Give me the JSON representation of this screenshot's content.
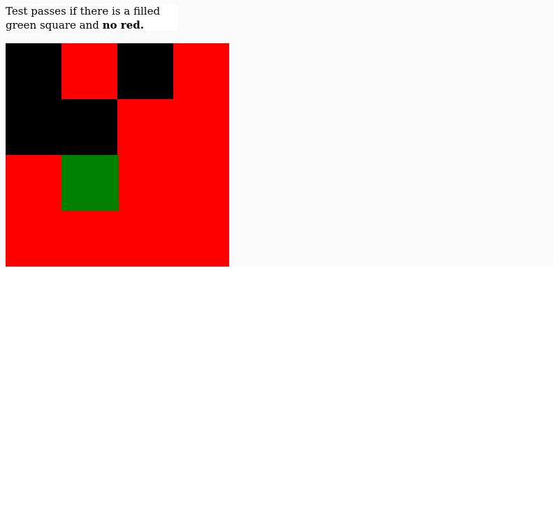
{
  "instructions": {
    "line1": "Test passes if there is a filled",
    "line2_prefix": "green square and ",
    "line2_bold": "no red."
  },
  "colors": {
    "black": "#000000",
    "red": "#ff0000",
    "green": "#008000",
    "panel": "#fafafa",
    "page": "#ffffff"
  },
  "grid": {
    "columns": 4,
    "rows": 4,
    "cells": [
      [
        "black",
        "red",
        "black",
        "red"
      ],
      [
        "black",
        "black",
        "red",
        "red"
      ],
      [
        "red",
        "green",
        "red",
        "red"
      ],
      [
        "red",
        "red",
        "red",
        "red"
      ]
    ]
  }
}
